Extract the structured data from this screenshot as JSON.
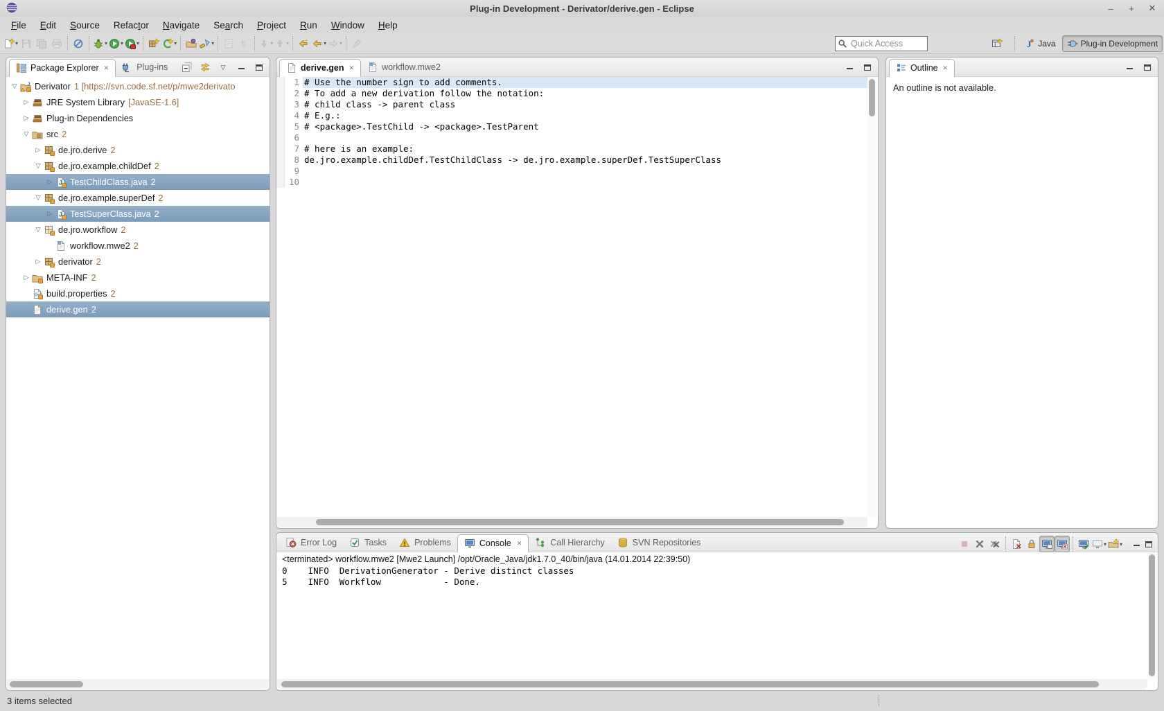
{
  "window": {
    "title": "Plug-in Development - Derivator/derive.gen - Eclipse",
    "controls": {
      "minimize": "–",
      "maximize": "+",
      "close": "✕"
    }
  },
  "menu": {
    "items": [
      {
        "label": "File",
        "m": 0,
        "name": "menu-file"
      },
      {
        "label": "Edit",
        "m": 0,
        "name": "menu-edit"
      },
      {
        "label": "Source",
        "m": 0,
        "name": "menu-source"
      },
      {
        "label": "Refactor",
        "m": 5,
        "name": "menu-refactor"
      },
      {
        "label": "Navigate",
        "m": 0,
        "name": "menu-navigate"
      },
      {
        "label": "Search",
        "m": 2,
        "name": "menu-search"
      },
      {
        "label": "Project",
        "m": 0,
        "name": "menu-project"
      },
      {
        "label": "Run",
        "m": 0,
        "name": "menu-run"
      },
      {
        "label": "Window",
        "m": 0,
        "name": "menu-window"
      },
      {
        "label": "Help",
        "m": 0,
        "name": "menu-help"
      }
    ]
  },
  "toolbar": {
    "buttons": [
      {
        "icon": "new",
        "dd": true,
        "name": "new-wizard-button"
      },
      {
        "icon": "save",
        "disabled": true,
        "name": "save-button"
      },
      {
        "icon": "saveall",
        "disabled": true,
        "name": "save-all-button"
      },
      {
        "icon": "print",
        "disabled": true,
        "name": "print-button"
      },
      {
        "sep": true
      },
      {
        "icon": "skipbp",
        "name": "skip-all-breakpoints-button"
      },
      {
        "sep": true
      },
      {
        "icon": "debug",
        "dd": true,
        "name": "debug-button"
      },
      {
        "icon": "run",
        "dd": true,
        "name": "run-button"
      },
      {
        "icon": "exttools",
        "dd": true,
        "name": "external-tools-button"
      },
      {
        "sep": true
      },
      {
        "icon": "newplugin",
        "name": "new-plugin-project-button"
      },
      {
        "icon": "codegen",
        "dd": true,
        "name": "code-generation-button"
      },
      {
        "sep": true
      },
      {
        "icon": "openartifact",
        "name": "open-plugin-artifact-button"
      },
      {
        "icon": "searchsrc",
        "dd": true,
        "name": "search-button"
      },
      {
        "sep": true
      },
      {
        "icon": "viewdoc",
        "disabled": true,
        "name": "show-source-button"
      },
      {
        "icon": "pilcrow",
        "disabled": true,
        "name": "show-whitespace-button"
      },
      {
        "sep": true
      },
      {
        "icon": "down",
        "disabled": true,
        "dd": true,
        "name": "next-annotation-button"
      },
      {
        "icon": "up",
        "disabled": true,
        "dd": true,
        "name": "previous-annotation-button"
      },
      {
        "sep": true
      },
      {
        "icon": "lastedit",
        "name": "last-edit-location-button"
      },
      {
        "icon": "back",
        "dd": true,
        "name": "back-button"
      },
      {
        "icon": "forward",
        "disabled": true,
        "dd": true,
        "name": "forward-button"
      },
      {
        "sep": true
      },
      {
        "icon": "pinedit",
        "disabled": true,
        "name": "pin-editor-button"
      }
    ],
    "quick_access": {
      "placeholder": "Quick Access"
    },
    "perspectives": [
      {
        "icon": "openpersp",
        "name": "open-perspective-button"
      },
      {
        "sep": true
      },
      {
        "icon": "javapersp",
        "label": "Java",
        "name": "perspective-java-button"
      },
      {
        "icon": "pdepersp",
        "label": "Plug-in Development",
        "active": true,
        "name": "perspective-plugin-development-button"
      }
    ]
  },
  "package_explorer": {
    "tabs": [
      {
        "label": "Package Explorer",
        "icon": "pkgexp",
        "active": true,
        "closable": true,
        "name": "tab-package-explorer"
      },
      {
        "label": "Plug-ins",
        "icon": "plugins",
        "name": "tab-plug-ins"
      }
    ],
    "tree": [
      {
        "label": "Derivator",
        "suffix": "1 [https://svn.code.sf.net/p/mwe2derivato",
        "icon": "project",
        "indent": 0,
        "expanded": true,
        "name": "tree-item-derivator"
      },
      {
        "label": "JRE System Library",
        "suffix": "[JavaSE-1.6]",
        "icon": "library",
        "indent": 1,
        "collapsed": true,
        "name": "tree-item-jre-system-library"
      },
      {
        "label": "Plug-in Dependencies",
        "suffix": "",
        "icon": "library",
        "indent": 1,
        "collapsed": true,
        "name": "tree-item-plugin-dependencies"
      },
      {
        "label": "src",
        "suffix": "2",
        "icon": "srcfolder",
        "indent": 1,
        "expanded": true,
        "name": "tree-item-src"
      },
      {
        "label": "de.jro.derive",
        "suffix": "2",
        "icon": "package",
        "indent": 2,
        "collapsed": true,
        "name": "tree-item-de-jro-derive"
      },
      {
        "label": "de.jro.example.childDef",
        "suffix": "2",
        "icon": "package",
        "indent": 2,
        "expanded": true,
        "name": "tree-item-de-jro-example-childdef"
      },
      {
        "label": "TestChildClass.java",
        "suffix": "2",
        "icon": "javafile",
        "indent": 3,
        "collapsed": true,
        "selected": true,
        "name": "tree-item-testchildclass-java"
      },
      {
        "label": "de.jro.example.superDef",
        "suffix": "2",
        "icon": "package",
        "indent": 2,
        "expanded": true,
        "name": "tree-item-de-jro-example-superdef"
      },
      {
        "label": "TestSuperClass.java",
        "suffix": "2",
        "icon": "javafile",
        "indent": 3,
        "collapsed": true,
        "selected": true,
        "name": "tree-item-testsuperclass-java"
      },
      {
        "label": "de.jro.workflow",
        "suffix": "2",
        "icon": "packageopen",
        "indent": 2,
        "expanded": true,
        "name": "tree-item-de-jro-workflow"
      },
      {
        "label": "workflow.mwe2",
        "suffix": "2",
        "icon": "mwe2",
        "indent": 3,
        "name": "tree-item-workflow-mwe2"
      },
      {
        "label": "derivator",
        "suffix": "2",
        "icon": "package",
        "indent": 2,
        "collapsed": true,
        "name": "tree-item-derivator-pkg"
      },
      {
        "label": "META-INF",
        "suffix": "2",
        "icon": "folder",
        "indent": 1,
        "collapsed": true,
        "name": "tree-item-meta-inf"
      },
      {
        "label": "build.properties",
        "suffix": "2",
        "icon": "propfile",
        "indent": 1,
        "name": "tree-item-build-properties"
      },
      {
        "label": "derive.gen",
        "suffix": "2",
        "icon": "doc",
        "indent": 1,
        "selected": true,
        "name": "tree-item-derive-gen"
      }
    ]
  },
  "editor": {
    "tabs": [
      {
        "label": "derive.gen",
        "icon": "doc",
        "active": true,
        "closable": true,
        "name": "editor-tab-derive-gen"
      },
      {
        "label": "workflow.mwe2",
        "icon": "mwe2",
        "name": "editor-tab-workflow-mwe2"
      }
    ],
    "lines": [
      {
        "n": "1",
        "text": "# Use the number sign to add comments.",
        "highlight": true
      },
      {
        "n": "2",
        "text": "# To add a new derivation follow the notation:"
      },
      {
        "n": "3",
        "text": "# child class -> parent class"
      },
      {
        "n": "4",
        "text": "# E.g.:"
      },
      {
        "n": "5",
        "text": "# <package>.TestChild -> <package>.TestParent"
      },
      {
        "n": "6",
        "text": ""
      },
      {
        "n": "7",
        "text": "# here is an example:"
      },
      {
        "n": "8",
        "text": "de.jro.example.childDef.TestChildClass -> de.jro.example.superDef.TestSuperClass"
      },
      {
        "n": "9",
        "text": ""
      },
      {
        "n": "10",
        "text": ""
      }
    ]
  },
  "outline": {
    "tab": {
      "label": "Outline",
      "icon": "outline",
      "active": true,
      "closable": true,
      "name": "tab-outline"
    },
    "message": "An outline is not available."
  },
  "console": {
    "tabs": [
      {
        "label": "Error Log",
        "icon": "errorlog",
        "name": "tab-error-log"
      },
      {
        "label": "Tasks",
        "icon": "tasks",
        "name": "tab-tasks"
      },
      {
        "label": "Problems",
        "icon": "problems",
        "name": "tab-problems"
      },
      {
        "label": "Console",
        "icon": "console",
        "active": true,
        "closable": true,
        "name": "tab-console"
      },
      {
        "label": "Call Hierarchy",
        "icon": "callh",
        "name": "tab-call-hierarchy"
      },
      {
        "label": "SVN Repositories",
        "icon": "svnrepo",
        "name": "tab-svn-repositories"
      }
    ],
    "toolbar": [
      {
        "icon": "terminate",
        "disabled": true,
        "name": "terminate-button"
      },
      {
        "icon": "removelaunch",
        "name": "remove-launch-button"
      },
      {
        "icon": "removeall",
        "name": "remove-all-terminated-button"
      },
      {
        "sep": true
      },
      {
        "icon": "clear",
        "name": "clear-console-button"
      },
      {
        "icon": "lock",
        "name": "scroll-lock-button"
      },
      {
        "icon": "stdoutmon",
        "pressed": true,
        "name": "show-console-on-stdout-button"
      },
      {
        "icon": "stderrmon",
        "pressed": true,
        "name": "show-console-on-stderr-button"
      },
      {
        "sep": true
      },
      {
        "icon": "pincon",
        "name": "pin-console-button"
      },
      {
        "icon": "displaycon",
        "dd": true,
        "name": "display-selected-console-button"
      },
      {
        "icon": "opencon",
        "dd": true,
        "name": "open-console-button"
      }
    ],
    "title": "<terminated> workflow.mwe2 [Mwe2 Launch] /opt/Oracle_Java/jdk1.7.0_40/bin/java (14.01.2014 22:39:50)",
    "output": [
      "0    INFO  DerivationGenerator - Derive distinct classes",
      "5    INFO  Workflow            - Done."
    ]
  },
  "status_bar": {
    "text": "3 items selected"
  },
  "colors": {
    "selection_top": "#93afca",
    "selection_bottom": "#7b9cba",
    "decorator_text": "#9a6e3f",
    "current_line": "#d9e8f8",
    "panel_border": "#ababab",
    "window_background": "#d8d8d8"
  }
}
